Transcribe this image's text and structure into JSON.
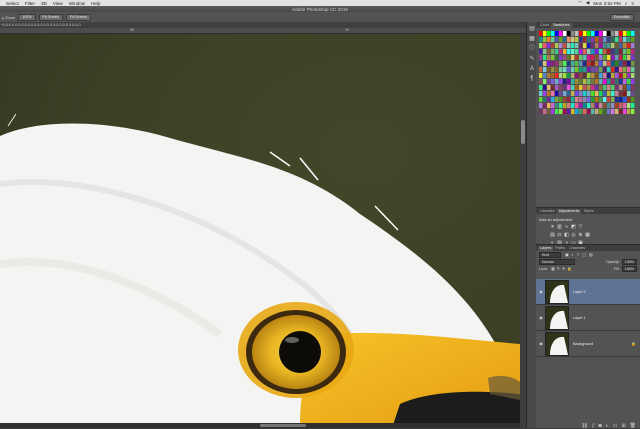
{
  "menubar": {
    "items": [
      "Select",
      "Filter",
      "3D",
      "View",
      "Window",
      "Help"
    ],
    "clock": "Mon 3:52 PM"
  },
  "titlebar": {
    "title": "Adobe Photoshop CC 2015"
  },
  "options": {
    "zoom_label": "y Zoom",
    "btn_100": "100%",
    "btn_fit": "Fit Screen",
    "btn_fill": "Fill Screen",
    "workspace": "Essentials"
  },
  "document": {
    "tab_title": "*0.0.0.0.0.0.0.0.0.0.0.0.0.0.0.0.0.0.0.0.0.0.0.0.0"
  },
  "ruler": {
    "ticks": [
      "38",
      "39"
    ]
  },
  "panels": {
    "swatch_tabs": [
      "Color",
      "Swatches"
    ],
    "adjust_tabs": [
      "Libraries",
      "Adjustments",
      "Styles"
    ],
    "adjust_title": "Add an adjustment",
    "layer_tabs": [
      "Layers",
      "Paths",
      "Channels"
    ],
    "kind_label": "Kind",
    "blend_mode": "Normal",
    "opacity_label": "Opacity:",
    "opacity_value": "100%",
    "lock_label": "Lock:",
    "fill_label": "Fill:",
    "fill_value": "100%",
    "layers": [
      {
        "name": "Layer 2"
      },
      {
        "name": "Layer 1"
      },
      {
        "name": "Background"
      }
    ]
  },
  "colors": {
    "canvas_bg": "#3b3f24",
    "selected_layer": "#5f7394",
    "beak": "#f2b51e"
  }
}
